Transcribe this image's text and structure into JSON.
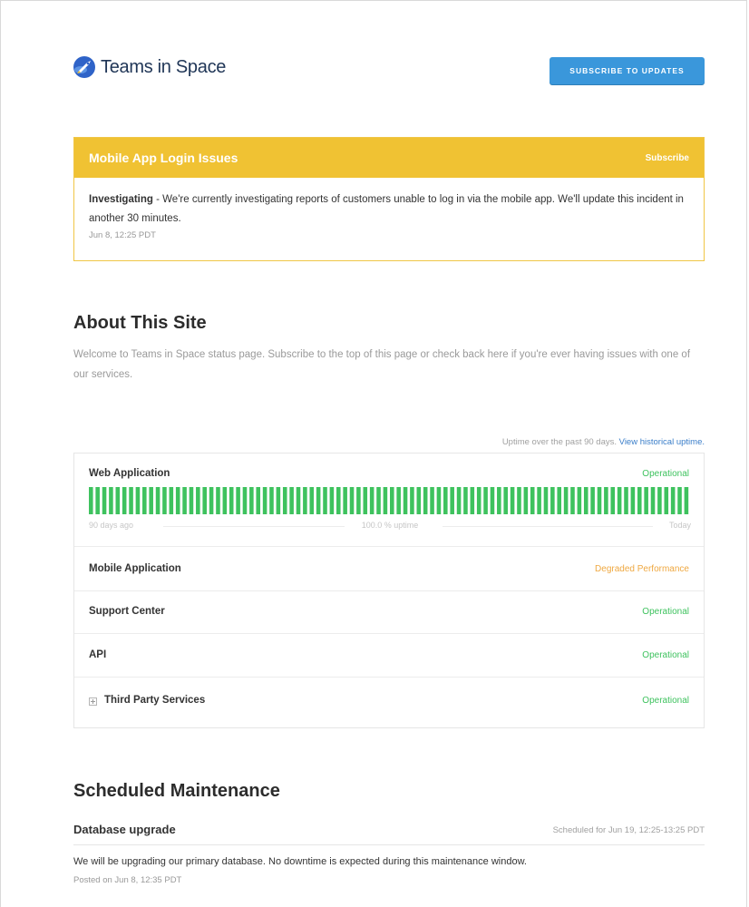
{
  "brand": {
    "name": "Teams in Space",
    "logo_icon": "rocket-globe-icon",
    "colors": {
      "brand_blue": "#2f63c8",
      "button_blue": "#3a97db"
    }
  },
  "header": {
    "subscribe_label": "SUBSCRIBE TO UPDATES"
  },
  "incident": {
    "title": "Mobile App Login Issues",
    "subscribe_label": "Subscribe",
    "status": "Investigating",
    "message": " - We're currently investigating reports of customers unable to log in via the mobile app. We'll update this incident in another 30 minutes.",
    "time": "Jun 8, 12:25 PDT",
    "color": "#f0c233"
  },
  "about": {
    "title": "About This Site",
    "text": "Welcome to Teams in Space status page. Subscribe to the top of this page or check back here if you're ever having issues with one of our services."
  },
  "uptime": {
    "note": "Uptime over the past 90 days. ",
    "link_label": "View historical uptime.",
    "days": 90,
    "bar_color": "#3ec25e",
    "start_label": "90 days ago",
    "percent_label": "100.0 % uptime",
    "end_label": "Today"
  },
  "components": [
    {
      "name": "Web Application",
      "status": "Operational"
    },
    {
      "name": "Mobile Application",
      "status": "Degraded Performance"
    },
    {
      "name": "Support Center",
      "status": "Operational"
    },
    {
      "name": "API",
      "status": "Operational"
    },
    {
      "name": "Third Party Services",
      "status": "Operational",
      "expandable": true,
      "icon": "expand-plus-icon"
    }
  ],
  "status_colors": {
    "Operational": "#3ec25e",
    "Degraded Performance": "#efa841"
  },
  "maintenance": {
    "title": "Scheduled Maintenance",
    "name": "Database upgrade",
    "scheduled": "Scheduled for Jun 19, 12:25-13:25 PDT",
    "text": "We will be upgrading our primary database. No downtime is expected during this maintenance window.",
    "posted": "Posted on Jun 8, 12:35 PDT"
  }
}
